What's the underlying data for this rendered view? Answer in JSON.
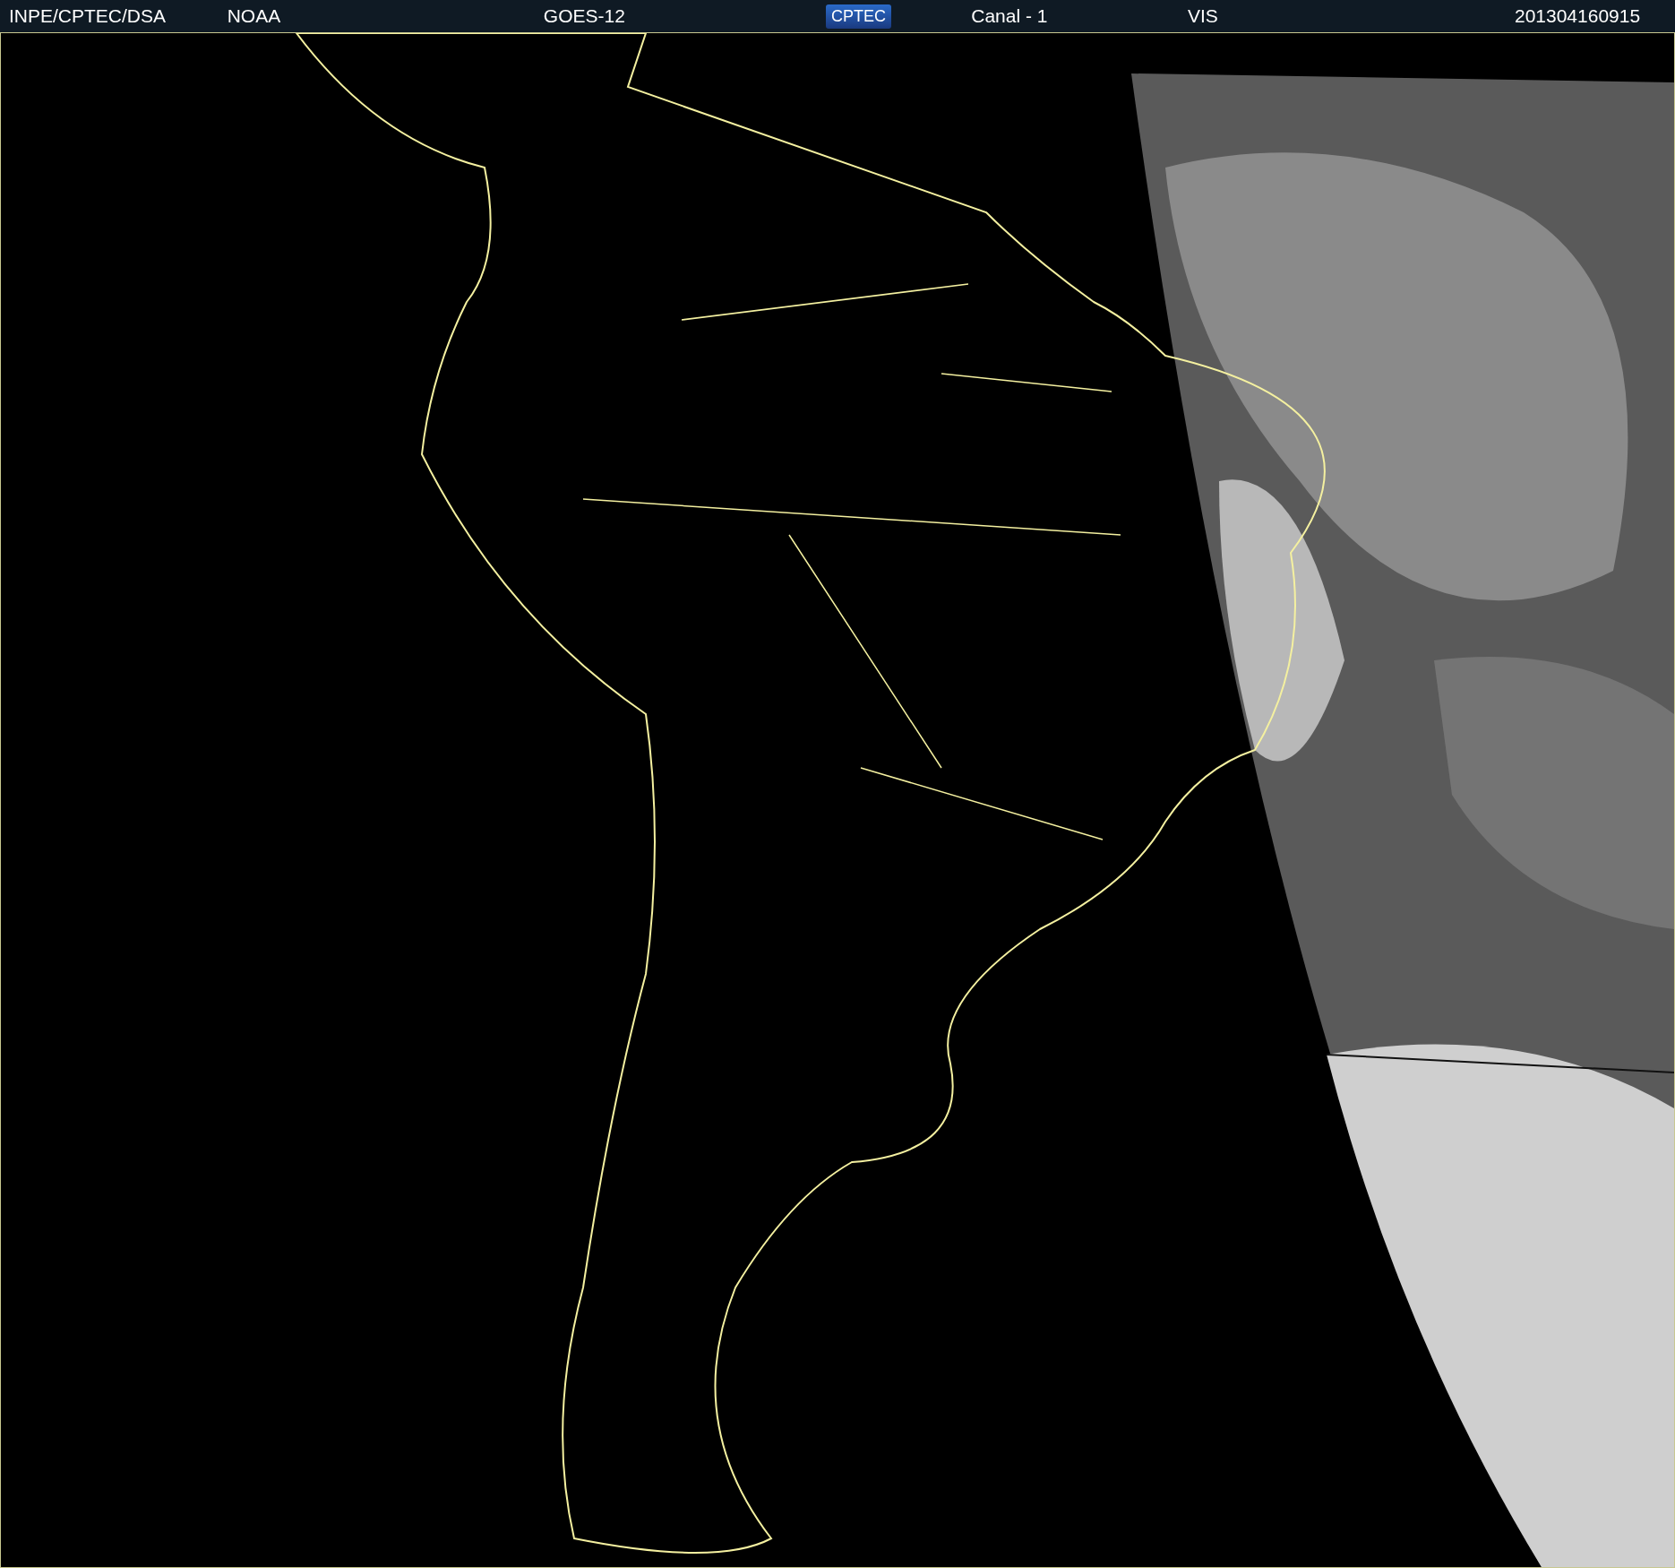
{
  "header": {
    "items": [
      {
        "kind": "text",
        "text": "INPE/CPTEC/DSA"
      },
      {
        "kind": "text",
        "text": "NOAA"
      },
      {
        "kind": "text",
        "text": "GOES-12"
      },
      {
        "kind": "logo",
        "text": "CPTEC"
      },
      {
        "kind": "text",
        "text": "Canal - 1"
      },
      {
        "kind": "text",
        "text": "VIS"
      },
      {
        "kind": "text",
        "text": "201304160915"
      }
    ]
  }
}
